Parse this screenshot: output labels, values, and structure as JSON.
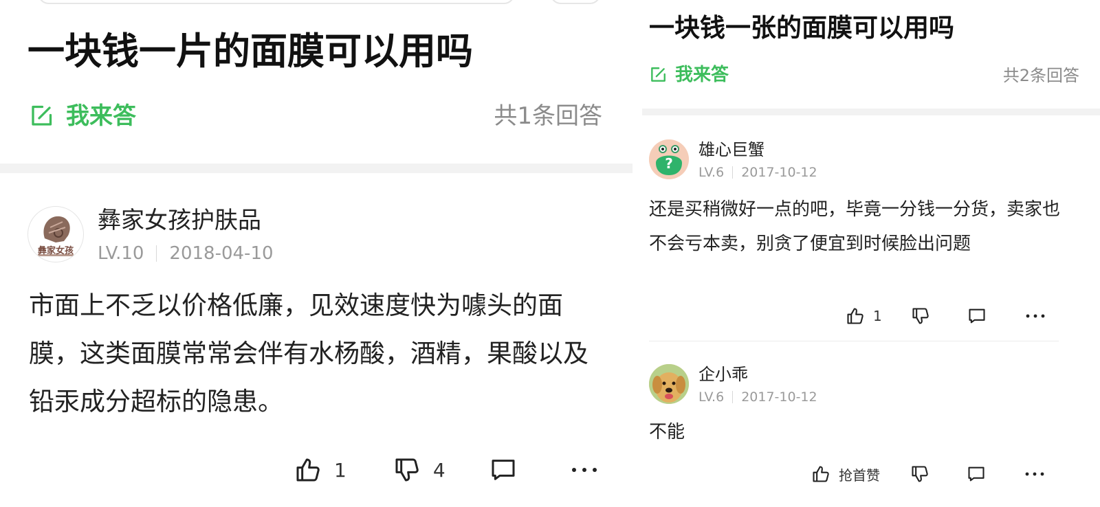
{
  "left": {
    "question_title": "一块钱一片的面膜可以用吗",
    "answer_label": "我来答",
    "answer_count": "共1条回答",
    "answer": {
      "author": "彝家女孩护肤品",
      "avatar_text": "彝家女孩",
      "level": "LV.10",
      "date": "2018-04-10",
      "content": "市面上不乏以价格低廉，见效速度快为噱头的面膜，这类面膜常常会伴有水杨酸，酒精，果酸以及铅汞成分超标的隐患。",
      "likes": "1",
      "dislikes": "4"
    }
  },
  "right": {
    "question_title": "一块钱一张的面膜可以用吗",
    "answer_label": "我来答",
    "answer_count": "共2条回答",
    "answers": [
      {
        "author": "雄心巨蟹",
        "level": "LV.6",
        "date": "2017-10-12",
        "content": "还是买稍微好一点的吧，毕竟一分钱一分货，卖家也不会亏本卖，别贪了便宜到时候脸出问题",
        "likes": "1"
      },
      {
        "author": "企小乖",
        "level": "LV.6",
        "date": "2017-10-12",
        "content": "不能",
        "like_label": "抢首赞"
      }
    ]
  },
  "colors": {
    "accent_green": "#3dbd5c",
    "muted_gray": "#8b8b8b",
    "divider_gray": "#f2f2f2"
  },
  "icons": [
    "edit-icon",
    "thumb-up-icon",
    "thumb-down-icon",
    "comment-icon",
    "more-icon",
    "question-avatar-icon",
    "dog-avatar-icon"
  ]
}
